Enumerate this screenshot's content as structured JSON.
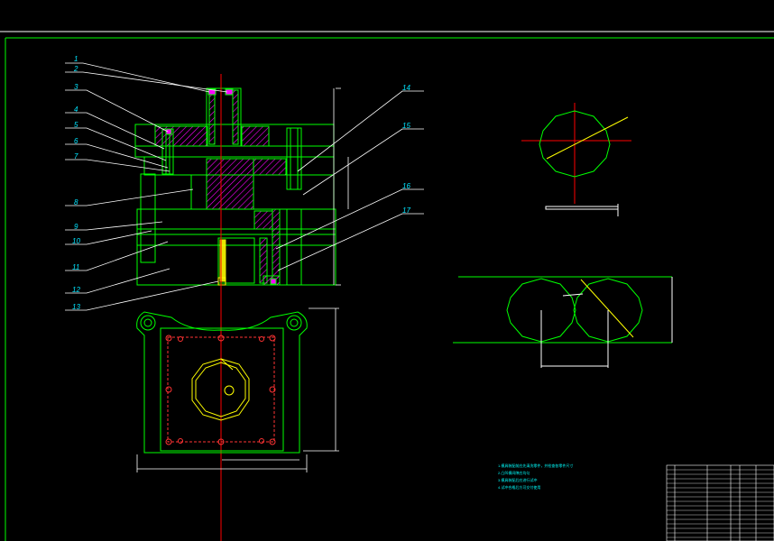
{
  "drawing": {
    "part_labels": [
      "1",
      "2",
      "3",
      "4",
      "5",
      "6",
      "7",
      "8",
      "9",
      "10",
      "11",
      "12",
      "13",
      "14",
      "15",
      "16",
      "17"
    ],
    "notes": [
      "1.模具装配前应先清洗零件，并检查各零件尺寸",
      "2.凸凹模间隙应均匀",
      "3.模具装配后应进行试冲",
      "4.试冲合格后方可交付使用"
    ]
  },
  "colors": {
    "background": "#000000",
    "frame": "#00ff00",
    "outline": "#00ff00",
    "hatch": "#ff00ff",
    "centerline": "#ff0000",
    "leader": "#ffffff",
    "label": "#00e5ff",
    "dimension": "#ffff00",
    "hole": "#ff3333"
  }
}
